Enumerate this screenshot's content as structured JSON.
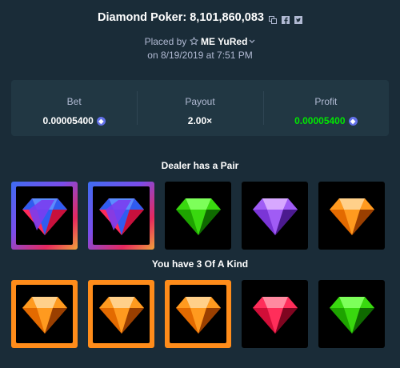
{
  "header": {
    "title": "Diamond Poker: 8,101,860,083",
    "placed_by_prefix": "Placed by",
    "username": "ME YuRed",
    "date": "on 8/19/2019 at 7:51 PM"
  },
  "stats": {
    "bet_label": "Bet",
    "bet_value": "0.00005400",
    "payout_label": "Payout",
    "payout_value": "2.00×",
    "profit_label": "Profit",
    "profit_value": "0.00005400"
  },
  "dealer": {
    "result": "Dealer has a Pair",
    "cards": [
      "rainbow",
      "rainbow",
      "green",
      "purple",
      "orange"
    ]
  },
  "player": {
    "result": "You have 3 Of A Kind",
    "cards": [
      "orange",
      "orange",
      "orange",
      "red",
      "green"
    ]
  },
  "colors": {
    "background": "#1a2c38",
    "panel": "#213743",
    "profit_green": "#00e701",
    "coin": "#6270e8",
    "kind_border": "#ff8c1a"
  }
}
